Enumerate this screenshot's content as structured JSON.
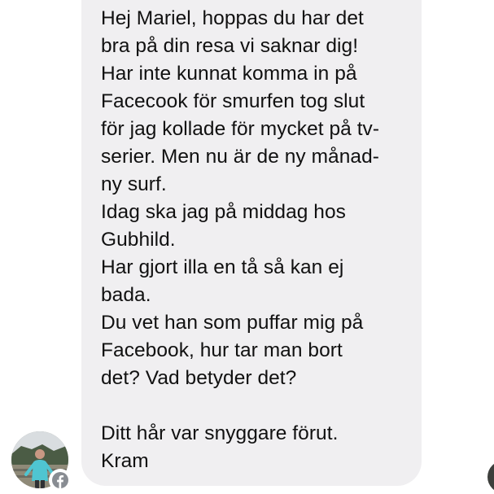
{
  "message": {
    "lines": [
      "Hej Mariel, hoppas du har det",
      "bra på din resa vi saknar dig!",
      "Har inte kunnat komma in på",
      "Facecook för smurfen tog slut",
      "för jag kollade för mycket på tv-",
      "serier. Men nu är de ny månad-",
      "ny surf.",
      "Idag ska jag på middag hos",
      "Gubhild.",
      "Har gjort illa en tå så kan ej",
      "bada.",
      "Du vet han som puffar mig på",
      "Facebook, hur tar man bort",
      "det? Vad betyder det?",
      "",
      "Ditt hår var snyggare förut.",
      "Kram"
    ]
  },
  "sender": {
    "avatar_icon": "profile-photo",
    "badge_icon": "facebook-icon"
  },
  "colors": {
    "bubble": "#f0eff1",
    "text": "#111111",
    "badge": "#888c92"
  }
}
